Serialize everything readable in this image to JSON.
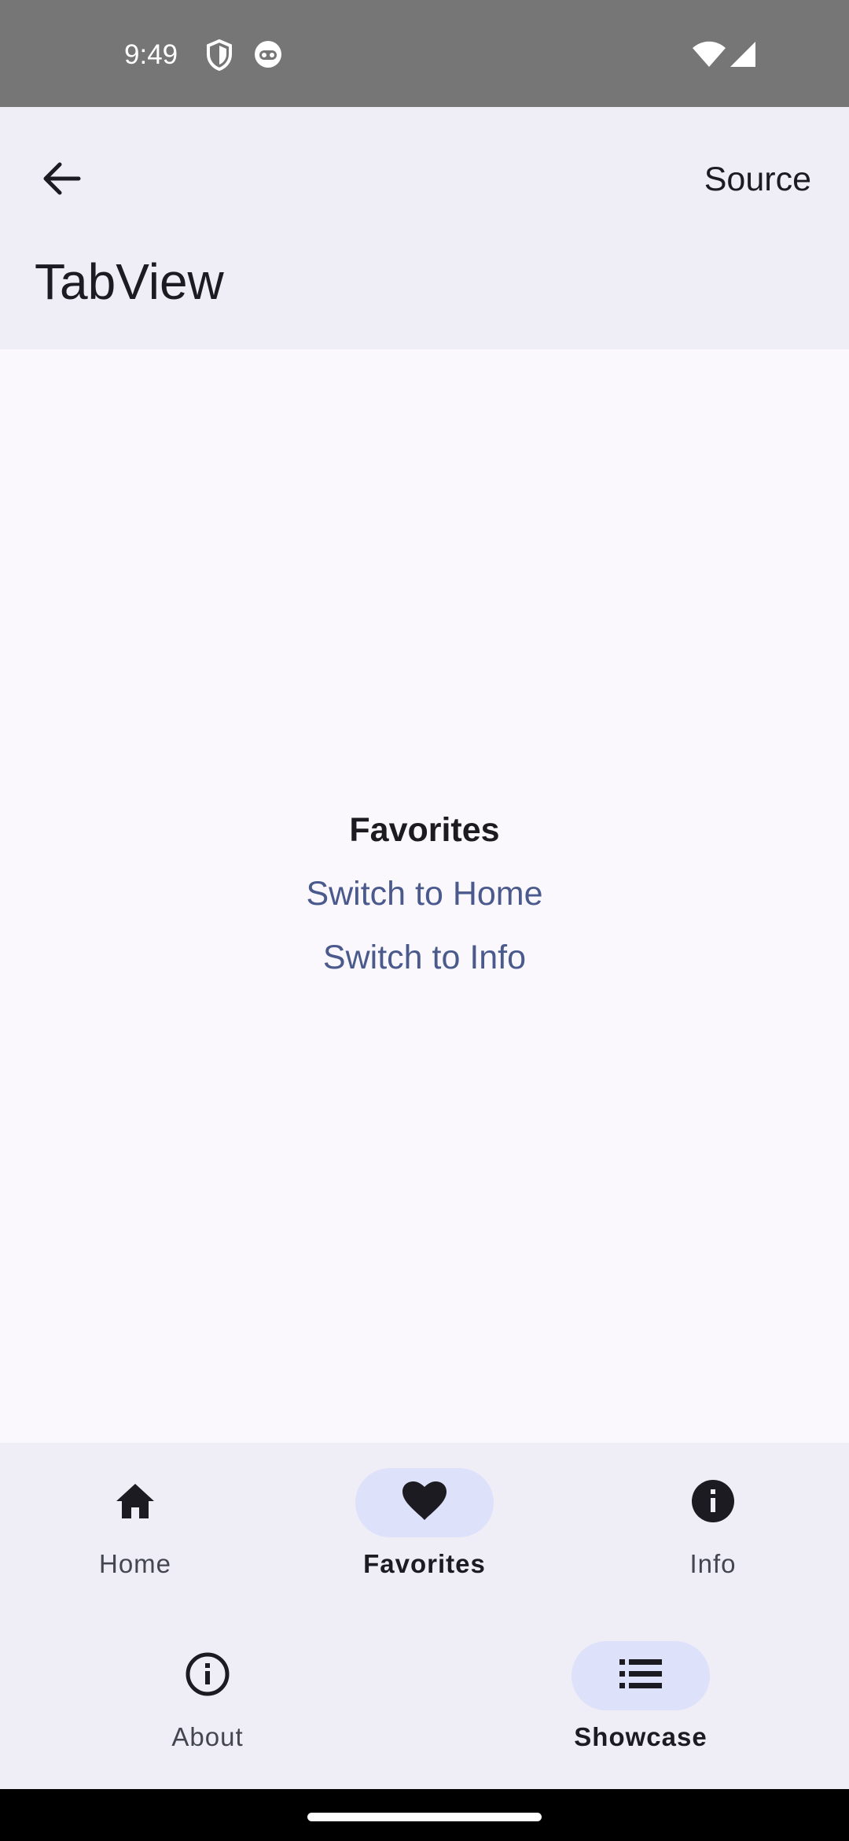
{
  "status_bar": {
    "time": "9:49",
    "icons": [
      "shield-icon",
      "face-icon",
      "wifi-icon",
      "signal-icon"
    ]
  },
  "app_bar": {
    "back_icon": "arrow-left-icon",
    "action_label": "Source",
    "title": "TabView"
  },
  "content": {
    "heading": "Favorites",
    "links": [
      "Switch to Home",
      "Switch to Info"
    ],
    "link_color": "#4a5a8d"
  },
  "tab_bar": {
    "items": [
      {
        "label": "Home",
        "icon": "home-icon",
        "selected": false
      },
      {
        "label": "Favorites",
        "icon": "heart-icon",
        "selected": true
      },
      {
        "label": "Info",
        "icon": "info-filled-icon",
        "selected": false
      }
    ]
  },
  "bottom_nav": {
    "items": [
      {
        "label": "About",
        "icon": "info-outline-icon",
        "selected": false
      },
      {
        "label": "Showcase",
        "icon": "list-icon",
        "selected": true
      }
    ]
  },
  "colors": {
    "status_bar": "#767676",
    "surface": "#efedf6",
    "background": "#fbf8fd",
    "indicator": "#dde1f9"
  }
}
